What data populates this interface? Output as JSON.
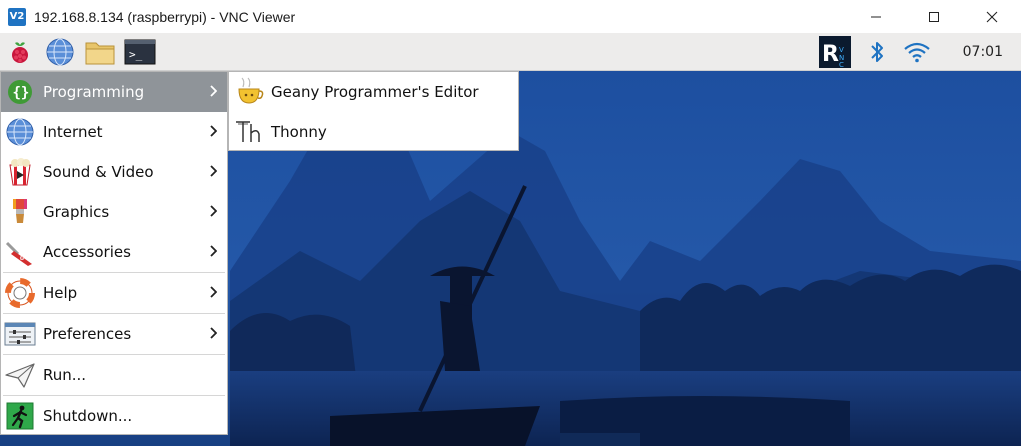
{
  "window": {
    "title": "192.168.8.134 (raspberrypi) - VNC Viewer",
    "logo_text": "V2"
  },
  "taskbar": {
    "clock": "07:01",
    "launchers": [
      "raspberry-menu-icon",
      "web-browser-icon",
      "file-manager-icon",
      "terminal-icon"
    ],
    "tray": [
      "realvnc-icon",
      "bluetooth-icon",
      "wifi-icon"
    ]
  },
  "menu": {
    "items": [
      {
        "label": "Programming",
        "icon": "programming-icon",
        "submenu": true
      },
      {
        "label": "Internet",
        "icon": "internet-icon",
        "submenu": true
      },
      {
        "label": "Sound & Video",
        "icon": "sound-video-icon",
        "submenu": true
      },
      {
        "label": "Graphics",
        "icon": "graphics-icon",
        "submenu": true
      },
      {
        "label": "Accessories",
        "icon": "accessories-icon",
        "submenu": true
      },
      {
        "label": "Help",
        "icon": "help-icon",
        "submenu": true
      },
      {
        "label": "Preferences",
        "icon": "preferences-icon",
        "submenu": true
      },
      {
        "label": "Run...",
        "icon": "run-icon",
        "submenu": false
      },
      {
        "label": "Shutdown...",
        "icon": "shutdown-icon",
        "submenu": false
      }
    ]
  },
  "submenu": {
    "items": [
      {
        "label": "Geany Programmer's Editor",
        "icon": "geany-icon"
      },
      {
        "label": "Thonny",
        "icon": "thonny-icon"
      }
    ]
  },
  "colors": {
    "menu_highlight": "#8f9499",
    "panel_bg": "#edeceb",
    "wallpaper_sky": "#1e4c9a"
  }
}
